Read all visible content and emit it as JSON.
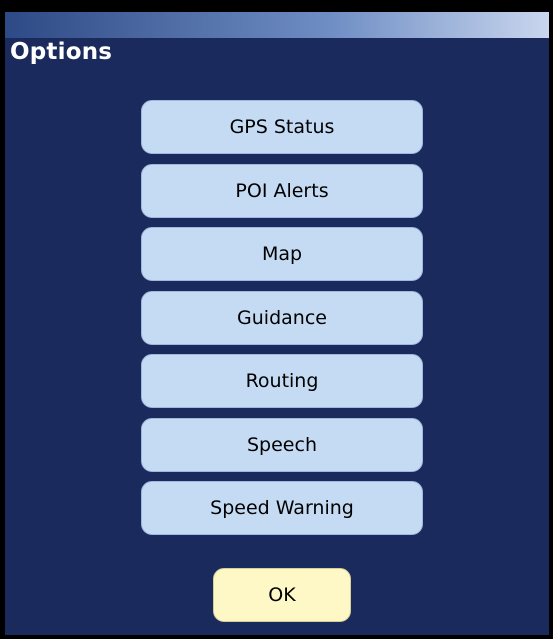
{
  "window": {
    "title": "Options"
  },
  "menu": {
    "items": [
      {
        "label": "GPS Status"
      },
      {
        "label": "POI Alerts"
      },
      {
        "label": "Map"
      },
      {
        "label": "Guidance"
      },
      {
        "label": "Routing"
      },
      {
        "label": "Speech"
      },
      {
        "label": "Speed Warning"
      }
    ]
  },
  "footer": {
    "ok_label": "OK"
  },
  "colors": {
    "background": "#1b2a5c",
    "menu_button": "#c4dbf3",
    "ok_button": "#fef7c6",
    "title_text": "#ffffff"
  }
}
